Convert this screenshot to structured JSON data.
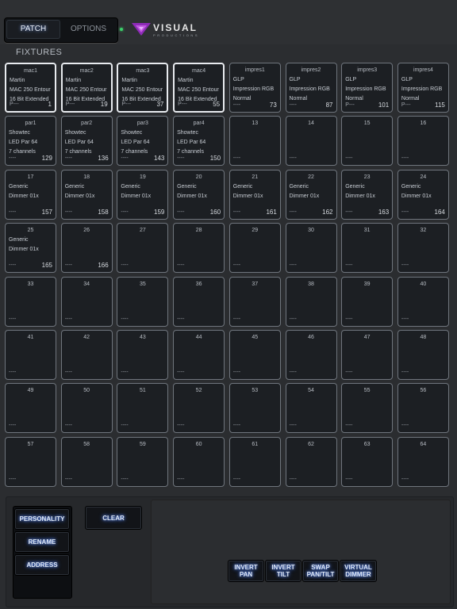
{
  "tabs": {
    "patch": "PATCH",
    "options": "OPTIONS"
  },
  "logo": {
    "word": "VISUAL",
    "sub": "PRODUCTIONS"
  },
  "section_title": "FIXTURES",
  "fixtures": [
    {
      "name": "mac1",
      "l1": "Martin",
      "l2": "MAC 250 Entour",
      "l3": "16 Bit Extended",
      "foot": "P---",
      "addr": "1",
      "sel": true
    },
    {
      "name": "mac2",
      "l1": "Martin",
      "l2": "MAC 250 Entour",
      "l3": "16 Bit Extended",
      "foot": "P---",
      "addr": "19",
      "sel": true
    },
    {
      "name": "mac3",
      "l1": "Martin",
      "l2": "MAC 250 Entour",
      "l3": "16 Bit Extended",
      "foot": "P---",
      "addr": "37",
      "sel": true
    },
    {
      "name": "mac4",
      "l1": "Martin",
      "l2": "MAC 250 Entour",
      "l3": "16 Bit Extended",
      "foot": "P---",
      "addr": "55",
      "sel": true
    },
    {
      "name": "impres1",
      "l1": "GLP",
      "l2": "Impression RGB",
      "l3": "Normal",
      "foot": "----",
      "addr": "73"
    },
    {
      "name": "impres2",
      "l1": "GLP",
      "l2": "Impression RGB",
      "l3": "Normal",
      "foot": "----",
      "addr": "87"
    },
    {
      "name": "impres3",
      "l1": "GLP",
      "l2": "Impression RGB",
      "l3": "Normal",
      "foot": "P---",
      "addr": "101"
    },
    {
      "name": "impres4",
      "l1": "GLP",
      "l2": "Impression RGB",
      "l3": "Normal",
      "foot": "P---",
      "addr": "115"
    },
    {
      "name": "par1",
      "l1": "Showtec",
      "l2": "LED Par 64",
      "l3": "7 channels",
      "foot": "----",
      "addr": "129"
    },
    {
      "name": "par2",
      "l1": "Showtec",
      "l2": "LED Par 64",
      "l3": "7 channels",
      "foot": "----",
      "addr": "136"
    },
    {
      "name": "par3",
      "l1": "Showtec",
      "l2": "LED Par 64",
      "l3": "7 channels",
      "foot": "----",
      "addr": "143"
    },
    {
      "name": "par4",
      "l1": "Showtec",
      "l2": "LED Par 64",
      "l3": "7 channels",
      "foot": "----",
      "addr": "150"
    },
    {
      "name": "13",
      "foot": "----"
    },
    {
      "name": "14",
      "foot": "----"
    },
    {
      "name": "15",
      "foot": "----"
    },
    {
      "name": "16",
      "foot": "----"
    },
    {
      "name": "17",
      "l1": "Generic",
      "l2": "Dimmer 01x",
      "foot": "----",
      "addr": "157"
    },
    {
      "name": "18",
      "l1": "Generic",
      "l2": "Dimmer 01x",
      "foot": "----",
      "addr": "158"
    },
    {
      "name": "19",
      "l1": "Generic",
      "l2": "Dimmer 01x",
      "foot": "----",
      "addr": "159"
    },
    {
      "name": "20",
      "l1": "Generic",
      "l2": "Dimmer 01x",
      "foot": "----",
      "addr": "160"
    },
    {
      "name": "21",
      "l1": "Generic",
      "l2": "Dimmer 01x",
      "foot": "----",
      "addr": "161"
    },
    {
      "name": "22",
      "l1": "Generic",
      "l2": "Dimmer 01x",
      "foot": "----",
      "addr": "162"
    },
    {
      "name": "23",
      "l1": "Generic",
      "l2": "Dimmer 01x",
      "foot": "----",
      "addr": "163"
    },
    {
      "name": "24",
      "l1": "Generic",
      "l2": "Dimmer 01x",
      "foot": "----",
      "addr": "164"
    },
    {
      "name": "25",
      "l1": "Generic",
      "l2": "Dimmer 01x",
      "foot": "----",
      "addr": "165"
    },
    {
      "name": "26",
      "foot": "----",
      "addr": "166"
    },
    {
      "name": "27",
      "foot": "----"
    },
    {
      "name": "28",
      "foot": "----"
    },
    {
      "name": "29",
      "foot": "----"
    },
    {
      "name": "30",
      "foot": "----"
    },
    {
      "name": "31",
      "foot": "----"
    },
    {
      "name": "32",
      "foot": "----"
    },
    {
      "name": "33",
      "foot": "----"
    },
    {
      "name": "34",
      "foot": "----"
    },
    {
      "name": "35",
      "foot": "----"
    },
    {
      "name": "36",
      "foot": "----"
    },
    {
      "name": "37",
      "foot": "----"
    },
    {
      "name": "38",
      "foot": "----"
    },
    {
      "name": "39",
      "foot": "----"
    },
    {
      "name": "40",
      "foot": "----"
    },
    {
      "name": "41",
      "foot": "----"
    },
    {
      "name": "42",
      "foot": "----"
    },
    {
      "name": "43",
      "foot": "----"
    },
    {
      "name": "44",
      "foot": "----"
    },
    {
      "name": "45",
      "foot": "----"
    },
    {
      "name": "46",
      "foot": "----"
    },
    {
      "name": "47",
      "foot": "----"
    },
    {
      "name": "48",
      "foot": "----"
    },
    {
      "name": "49",
      "foot": "----"
    },
    {
      "name": "50",
      "foot": "----"
    },
    {
      "name": "51",
      "foot": "----"
    },
    {
      "name": "52",
      "foot": "----"
    },
    {
      "name": "53",
      "foot": "----"
    },
    {
      "name": "54",
      "foot": "----"
    },
    {
      "name": "55",
      "foot": "----"
    },
    {
      "name": "56",
      "foot": "----"
    },
    {
      "name": "57",
      "foot": "----"
    },
    {
      "name": "58",
      "foot": "----"
    },
    {
      "name": "59",
      "foot": "----"
    },
    {
      "name": "60",
      "foot": "----"
    },
    {
      "name": "61",
      "foot": "----"
    },
    {
      "name": "62",
      "foot": "----"
    },
    {
      "name": "63",
      "foot": "----"
    },
    {
      "name": "64",
      "foot": "----"
    }
  ],
  "buttons": {
    "personality": "PERSONALITY",
    "rename": "RENAME",
    "address": "ADDRESS",
    "clear": "CLEAR",
    "invert_pan": [
      "INVERT",
      "PAN"
    ],
    "invert_tilt": [
      "INVERT",
      "TILT"
    ],
    "swap": [
      "SWAP",
      "PAN/TILT"
    ],
    "virtual_dimmer": [
      "VIRTUAL",
      "DIMMER"
    ]
  },
  "colors": {
    "led": "#3cd06b",
    "logo_purple": "#8e2bb8"
  }
}
